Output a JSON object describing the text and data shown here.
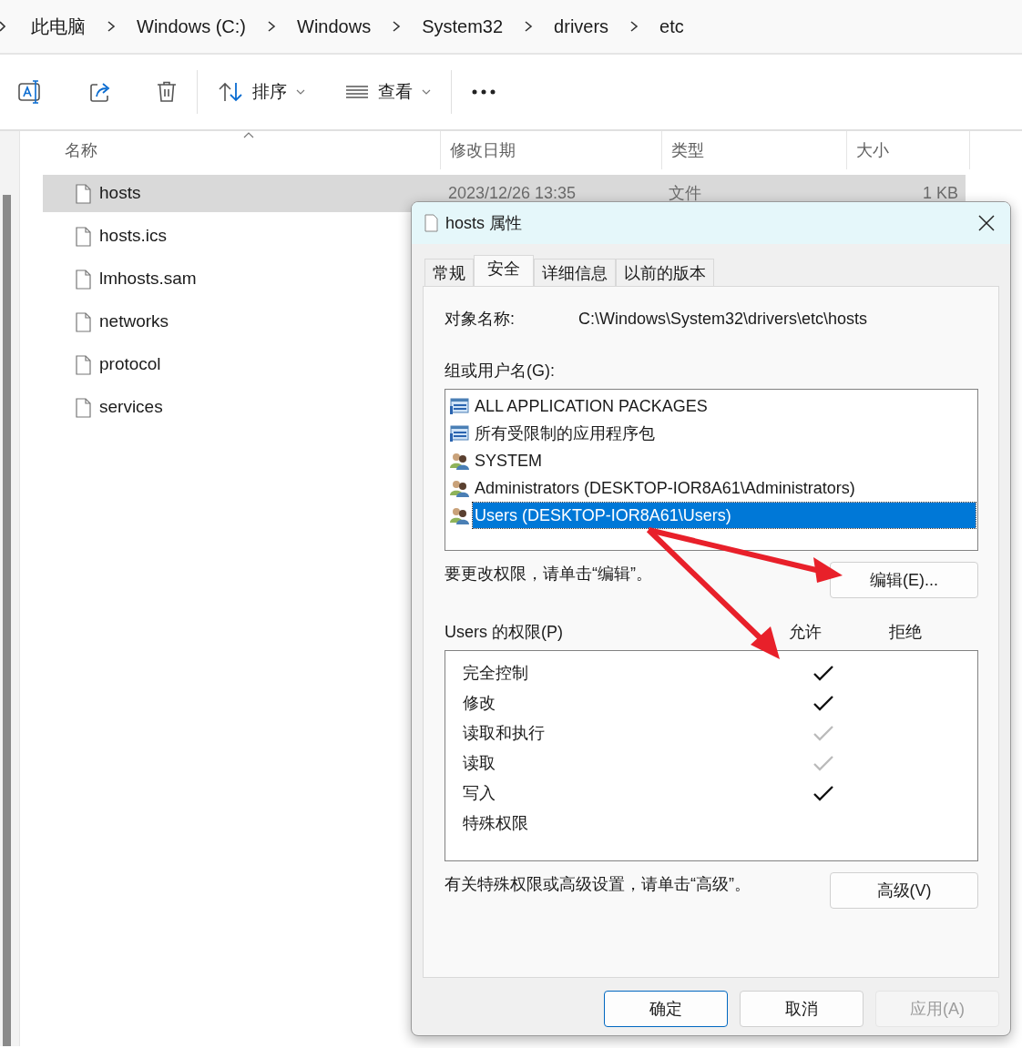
{
  "breadcrumb": [
    "此电脑",
    "Windows (C:)",
    "Windows",
    "System32",
    "drivers",
    "etc"
  ],
  "toolbar": {
    "sort": "排序",
    "view": "查看"
  },
  "columns": [
    "名称",
    "修改日期",
    "类型",
    "大小"
  ],
  "files": [
    {
      "name": "hosts",
      "date": "2023/12/26 13:35",
      "type": "文件",
      "size": "1 KB",
      "selected": true
    },
    {
      "name": "hosts.ics",
      "selected": false
    },
    {
      "name": "lmhosts.sam",
      "selected": false
    },
    {
      "name": "networks",
      "selected": false
    },
    {
      "name": "protocol",
      "selected": false
    },
    {
      "name": "services",
      "selected": false
    }
  ],
  "dialog": {
    "title": "hosts 属性",
    "tabs": [
      {
        "label": "常规",
        "selected": false
      },
      {
        "label": "安全",
        "selected": true
      },
      {
        "label": "详细信息",
        "selected": false
      },
      {
        "label": "以前的版本",
        "selected": false
      }
    ],
    "object_label": "对象名称:",
    "object_value": "C:\\Windows\\System32\\drivers\\etc\\hosts",
    "groups_label": "组或用户名(G):",
    "groups": [
      {
        "name": "ALL APPLICATION PACKAGES",
        "kind": "package",
        "selected": false
      },
      {
        "name": "所有受限制的应用程序包",
        "kind": "package",
        "selected": false
      },
      {
        "name": "SYSTEM",
        "kind": "users",
        "selected": false
      },
      {
        "name": "Administrators (DESKTOP-IOR8A61\\Administrators)",
        "kind": "users",
        "selected": false
      },
      {
        "name": "Users (DESKTOP-IOR8A61\\Users)",
        "kind": "users",
        "selected": true
      }
    ],
    "edit_hint": "要更改权限，请单击“编辑”。",
    "edit_button": "编辑(E)...",
    "perm_label": "Users 的权限(P)",
    "allow_label": "允许",
    "deny_label": "拒绝",
    "permissions": [
      {
        "name": "完全控制",
        "allow": true,
        "inherited": false
      },
      {
        "name": "修改",
        "allow": true,
        "inherited": false
      },
      {
        "name": "读取和执行",
        "allow": true,
        "inherited": true
      },
      {
        "name": "读取",
        "allow": true,
        "inherited": true
      },
      {
        "name": "写入",
        "allow": true,
        "inherited": false
      },
      {
        "name": "特殊权限",
        "allow": false
      }
    ],
    "advanced_hint": "有关特殊权限或高级设置，请单击“高级”。",
    "advanced_button": "高级(V)",
    "buttons": [
      {
        "label": "确定",
        "disabled": false,
        "default": true
      },
      {
        "label": "取消",
        "disabled": false,
        "default": false
      },
      {
        "label": "应用(A)",
        "disabled": true,
        "default": false
      }
    ]
  }
}
